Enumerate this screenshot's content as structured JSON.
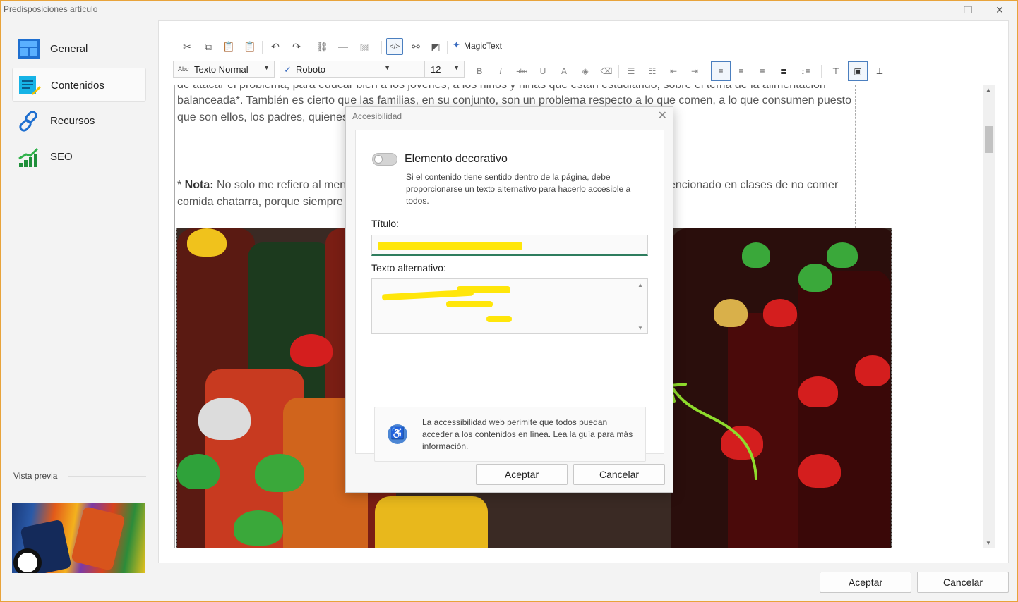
{
  "window": {
    "title": "Predisposiciones artículo",
    "restore_icon": "restore-icon",
    "close_icon": "close-icon"
  },
  "sidebar": {
    "items": [
      {
        "label": "General",
        "icon": "layout-icon",
        "active": false
      },
      {
        "label": "Contenidos",
        "icon": "document-edit-icon",
        "active": true
      },
      {
        "label": "Recursos",
        "icon": "link-icon",
        "active": false
      },
      {
        "label": "SEO",
        "icon": "chart-growth-icon",
        "active": false
      }
    ],
    "preview_label": "Vista previa"
  },
  "toolbar": {
    "icons": [
      "cut-icon",
      "copy-icon",
      "paste-icon",
      "paste-text-icon",
      "undo-icon",
      "redo-icon",
      "link-icon",
      "horizontal-rule-icon",
      "image-icon",
      "source-code-icon",
      "unlink-icon",
      "contrast-icon"
    ],
    "magic_text": "MagicText",
    "style_select": "Texto Normal",
    "style_prefix": "Abc",
    "font_select": "Roboto",
    "size_select": "12",
    "format_icons": [
      "bold-icon",
      "italic-icon",
      "strikethrough-icon",
      "underline-icon",
      "font-color-icon",
      "highlight-icon",
      "clear-format-icon",
      "bullet-list-icon",
      "numbered-list-icon",
      "outdent-icon",
      "indent-icon",
      "align-left-icon",
      "align-center-icon",
      "align-right-icon",
      "justify-icon",
      "line-height-icon",
      "image-wrap-top-icon",
      "image-wrap-middle-icon",
      "image-wrap-bottom-icon"
    ]
  },
  "editor": {
    "line1": "de atacar el problema, para educar bien a los jóvenes, a los niños y niñas que están estudiando, sobre el tema de la alimentación",
    "line2": "balanceada*. También es cierto que las familias, en su conjunto, son un problema respecto a lo que comen, a lo que consumen puesto",
    "line3": "que son ellos, los padres, quienes",
    "note_prefix": "* ",
    "note_bold": "Nota:",
    "note_text": " No solo me refiero al ment",
    "note_right": "encionado en clases de no comer",
    "note_line2": "comida chatarra, porque siempre s"
  },
  "dialog": {
    "title": "Accesibilidad",
    "decorative_label": "Elemento decorativo",
    "decorative_on": false,
    "decorative_desc": "Si el contenido tiene sentido dentro de la página, debe proporcionarse un texto alternativo para hacerlo accesible a todos.",
    "title_label": "Título:",
    "title_value": "",
    "alt_label": "Texto alternativo:",
    "alt_value": "",
    "info_text": "La accessibilidad web perimite que todos puedan acceder a los contenidos en línea. Lea la guía para más información.",
    "accept": "Aceptar",
    "cancel": "Cancelar",
    "highlight_color": "#ffe60a"
  },
  "footer": {
    "accept": "Aceptar",
    "cancel": "Cancelar"
  },
  "colors": {
    "window_border": "#e8a33a",
    "accent": "#4b7fbf",
    "annotation_arrow": "#8fdc2c"
  }
}
